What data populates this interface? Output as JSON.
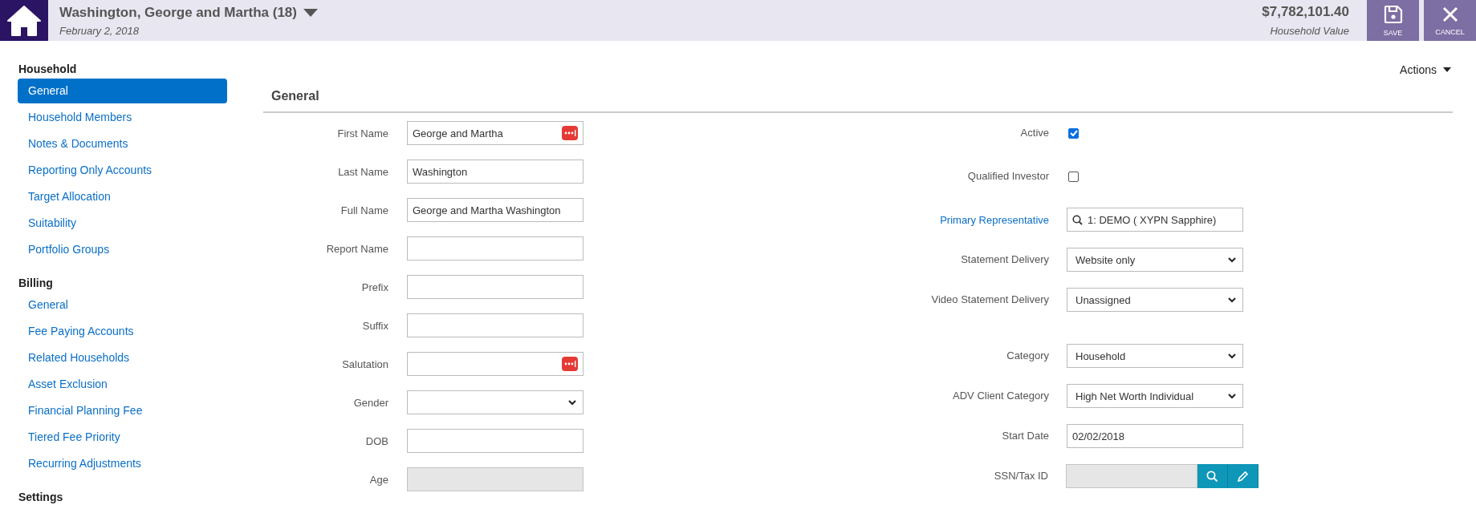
{
  "header": {
    "title": "Washington, George and Martha (18)",
    "date": "February 2, 2018",
    "value": "$7,782,101.40",
    "value_label": "Household Value",
    "buttons": [
      {
        "kind": "save",
        "label": "SAVE"
      },
      {
        "kind": "cancel",
        "label": "CANCEL"
      }
    ]
  },
  "sidebar": {
    "sections": [
      {
        "heading": "Household",
        "items": [
          {
            "label": "General",
            "selected": true
          },
          {
            "label": "Household Members",
            "selected": false
          },
          {
            "label": "Notes & Documents",
            "selected": false
          },
          {
            "label": "Reporting Only Accounts",
            "selected": false
          },
          {
            "label": "Target Allocation",
            "selected": false
          },
          {
            "label": "Suitability",
            "selected": false
          },
          {
            "label": "Portfolio Groups",
            "selected": false
          }
        ]
      },
      {
        "heading": "Billing",
        "items": [
          {
            "label": "General",
            "selected": false
          },
          {
            "label": "Fee Paying Accounts",
            "selected": false
          },
          {
            "label": "Related Households",
            "selected": false
          },
          {
            "label": "Asset Exclusion",
            "selected": false
          },
          {
            "label": "Financial Planning Fee",
            "selected": false
          },
          {
            "label": "Tiered Fee Priority",
            "selected": false
          },
          {
            "label": "Recurring Adjustments",
            "selected": false
          }
        ]
      },
      {
        "heading": "Settings"
      }
    ]
  },
  "actions": "Actions",
  "section_title": "General",
  "left_fields": [
    {
      "label": "First Name",
      "kind": "text",
      "value": "George and Martha",
      "addon": true,
      "disabled": false
    },
    {
      "label": "Last Name",
      "kind": "text",
      "value": "Washington",
      "addon": false,
      "disabled": false
    },
    {
      "label": "Full Name",
      "kind": "text",
      "value": "George and Martha Washington",
      "addon": false,
      "disabled": false
    },
    {
      "label": "Report Name",
      "kind": "text",
      "addon": false,
      "disabled": false
    },
    {
      "label": "Prefix",
      "kind": "text",
      "addon": false,
      "disabled": false
    },
    {
      "label": "Suffix",
      "kind": "text",
      "addon": false,
      "disabled": false
    },
    {
      "label": "Salutation",
      "kind": "text",
      "addon": true,
      "disabled": false
    },
    {
      "label": "Gender",
      "kind": "select",
      "addon": false,
      "disabled": false
    },
    {
      "label": "DOB",
      "kind": "text",
      "addon": false,
      "disabled": false
    },
    {
      "label": "Age",
      "kind": "text",
      "addon": false,
      "disabled": true
    }
  ],
  "right_fields": [
    {
      "label": "Active",
      "kind": "checkbox",
      "checked": true,
      "link": false
    },
    {
      "label": "Qualified Investor",
      "kind": "checkbox",
      "checked": false,
      "link": false
    },
    {
      "label": "Primary Representative",
      "kind": "lookup",
      "value": "1: DEMO (  XYPN Sapphire)",
      "link": true
    },
    {
      "label": "Statement Delivery",
      "kind": "select",
      "value": "Website only",
      "link": false
    },
    {
      "label": "Video Statement Delivery",
      "kind": "select",
      "value": "Unassigned",
      "link": false
    },
    {
      "label": "Category",
      "kind": "select",
      "value": "Household",
      "link": false
    },
    {
      "label": "ADV Client Category",
      "kind": "select",
      "value": "High Net Worth Individual",
      "link": false
    },
    {
      "label": "Start Date",
      "kind": "text",
      "value": "02/02/2018",
      "link": false
    },
    {
      "label": "SSN/Tax ID",
      "kind": "ssn",
      "link": false
    }
  ]
}
